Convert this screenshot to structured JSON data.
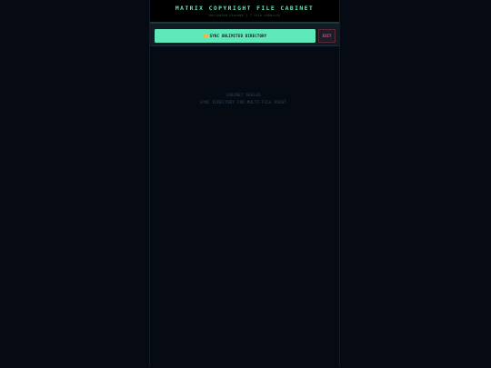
{
  "header": {
    "title": "MATRIX COPYRIGHT FILE CABINET",
    "subtitle": "encrypted storage | 7-file capacity"
  },
  "toolbar": {
    "sync_label": "SYNC UNLIMITED DIRECTORY",
    "sync_icon": "folder-icon",
    "exit_label": "EXIT"
  },
  "status": {
    "line1": "CABINET SEALED.",
    "line2": "SYNC DIRECTORY FOR MULTI-FILE ROOST."
  },
  "colors": {
    "accent": "#5ee8b9",
    "exit": "#d8557a",
    "background": "#060a13"
  }
}
